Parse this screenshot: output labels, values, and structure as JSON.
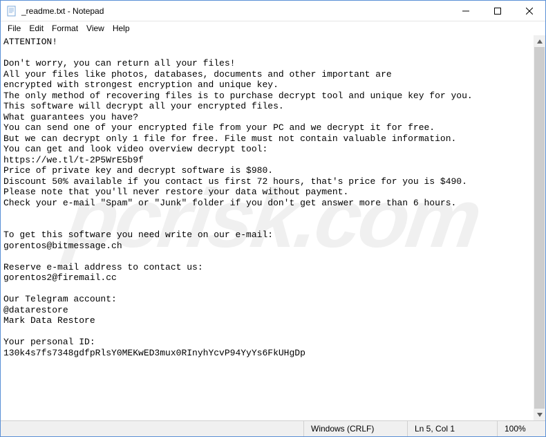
{
  "titlebar": {
    "title": "_readme.txt - Notepad"
  },
  "menu": {
    "file": "File",
    "edit": "Edit",
    "format": "Format",
    "view": "View",
    "help": "Help"
  },
  "content": "ATTENTION!\n\nDon't worry, you can return all your files!\nAll your files like photos, databases, documents and other important are\nencrypted with strongest encryption and unique key.\nThe only method of recovering files is to purchase decrypt tool and unique key for you.\nThis software will decrypt all your encrypted files.\nWhat guarantees you have?\nYou can send one of your encrypted file from your PC and we decrypt it for free.\nBut we can decrypt only 1 file for free. File must not contain valuable information.\nYou can get and look video overview decrypt tool:\nhttps://we.tl/t-2P5WrE5b9f\nPrice of private key and decrypt software is $980.\nDiscount 50% available if you contact us first 72 hours, that's price for you is $490.\nPlease note that you'll never restore your data without payment.\nCheck your e-mail \"Spam\" or \"Junk\" folder if you don't get answer more than 6 hours.\n\n\nTo get this software you need write on our e-mail:\ngorentos@bitmessage.ch\n\nReserve e-mail address to contact us:\ngorentos2@firemail.cc\n\nOur Telegram account:\n@datarestore\nMark Data Restore\n\nYour personal ID:\n130k4s7fs7348gdfpRlsY0MEKwED3mux0RInyhYcvP94YyYs6FkUHgDp",
  "status": {
    "encoding": "Windows (CRLF)",
    "position": "Ln 5, Col 1",
    "zoom": "100%"
  },
  "watermark": "pcrisk.com"
}
